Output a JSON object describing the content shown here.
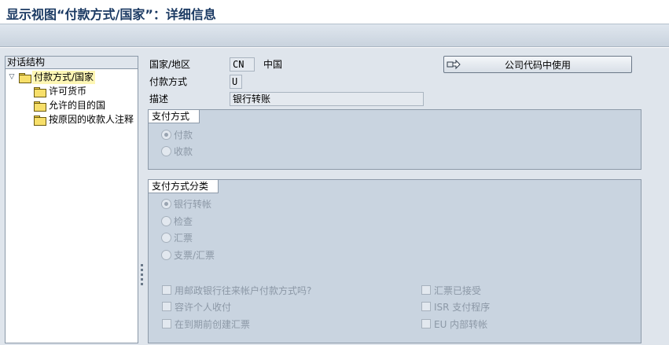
{
  "window": {
    "title": "显示视图“付款方式/国家”：详细信息"
  },
  "tree": {
    "header": "对话结构",
    "root": {
      "label": "付款方式/国家",
      "expanded": true,
      "selected": true
    },
    "children": [
      {
        "label": "许可货币"
      },
      {
        "label": "允许的目的国"
      },
      {
        "label": "按原因的收款人注释"
      }
    ]
  },
  "form": {
    "country": {
      "label": "国家/地区",
      "value": "CN",
      "name": "中国"
    },
    "payment_method": {
      "label": "付款方式",
      "value": "U"
    },
    "description": {
      "label": "描述",
      "value": "银行转账"
    },
    "company_code_button": "公司代码中使用"
  },
  "payment_type_group": {
    "title": "支付方式",
    "options": [
      {
        "label": "付款",
        "selected": true
      },
      {
        "label": "收款",
        "selected": false
      }
    ]
  },
  "classification_group": {
    "title": "支付方式分类",
    "options": [
      {
        "label": "银行转帐",
        "selected": true
      },
      {
        "label": "检查",
        "selected": false
      },
      {
        "label": "汇票",
        "selected": false
      },
      {
        "label": "支票/汇票",
        "selected": false
      }
    ],
    "checkboxes_left": [
      {
        "label": "用邮政银行往来帐户付款方式吗?",
        "checked": false
      },
      {
        "label": "容许个人收付",
        "checked": false
      },
      {
        "label": "在到期前创建汇票",
        "checked": false
      }
    ],
    "checkboxes_right": [
      {
        "label": "汇票已接受",
        "checked": false
      },
      {
        "label": "ISR 支付程序",
        "checked": false
      },
      {
        "label": "EU 内部转帐",
        "checked": false
      }
    ]
  }
}
